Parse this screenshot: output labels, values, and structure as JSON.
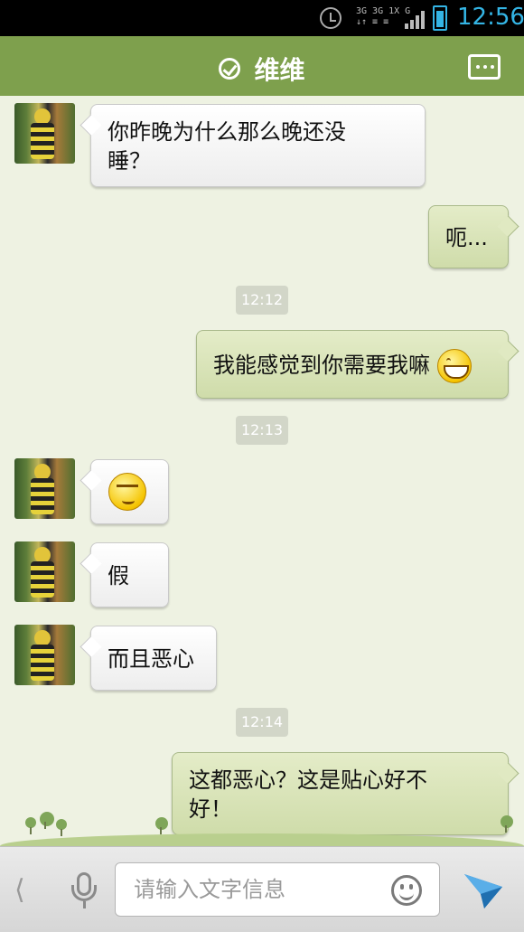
{
  "status_bar": {
    "time": "12:56",
    "network": [
      "3G 3G 1X G",
      "↓↑ ≡ ≡"
    ],
    "icons": [
      "alarm-icon",
      "signal-icon",
      "battery-icon"
    ]
  },
  "header": {
    "title": "维维",
    "verified_icon": "check-circle-icon",
    "menu_icon": "more-options-icon"
  },
  "messages": [
    {
      "side": "left",
      "text": "你昨晚为什么那么晚还没",
      "text2": "睡？"
    },
    {
      "side": "right",
      "text": "呃..."
    },
    {
      "type": "time",
      "text": "12:12"
    },
    {
      "side": "right",
      "text": "我能感觉到你需要我嘛",
      "emoji": "grin-emoji"
    },
    {
      "type": "time",
      "text": "12:13"
    },
    {
      "side": "left",
      "emoji": "salute-emoji"
    },
    {
      "side": "left",
      "text": "假"
    },
    {
      "side": "left",
      "text": "而且恶心"
    },
    {
      "type": "time",
      "text": "12:14"
    },
    {
      "side": "right",
      "text": "这都恶心？这是贴心好不",
      "text2": "好！"
    }
  ],
  "input_bar": {
    "back_icon": "chevron-left-icon",
    "voice_icon": "microphone-icon",
    "placeholder": "请输入文字信息",
    "emoji_icon": "smiley-icon",
    "send_icon": "send-icon"
  },
  "colors": {
    "header": "#7ea04d",
    "chat_bg": "#eef2e2",
    "sent_bubble": "#d6e2b4",
    "received_bubble": "#ffffff",
    "time_accent": "#34b5e5"
  }
}
